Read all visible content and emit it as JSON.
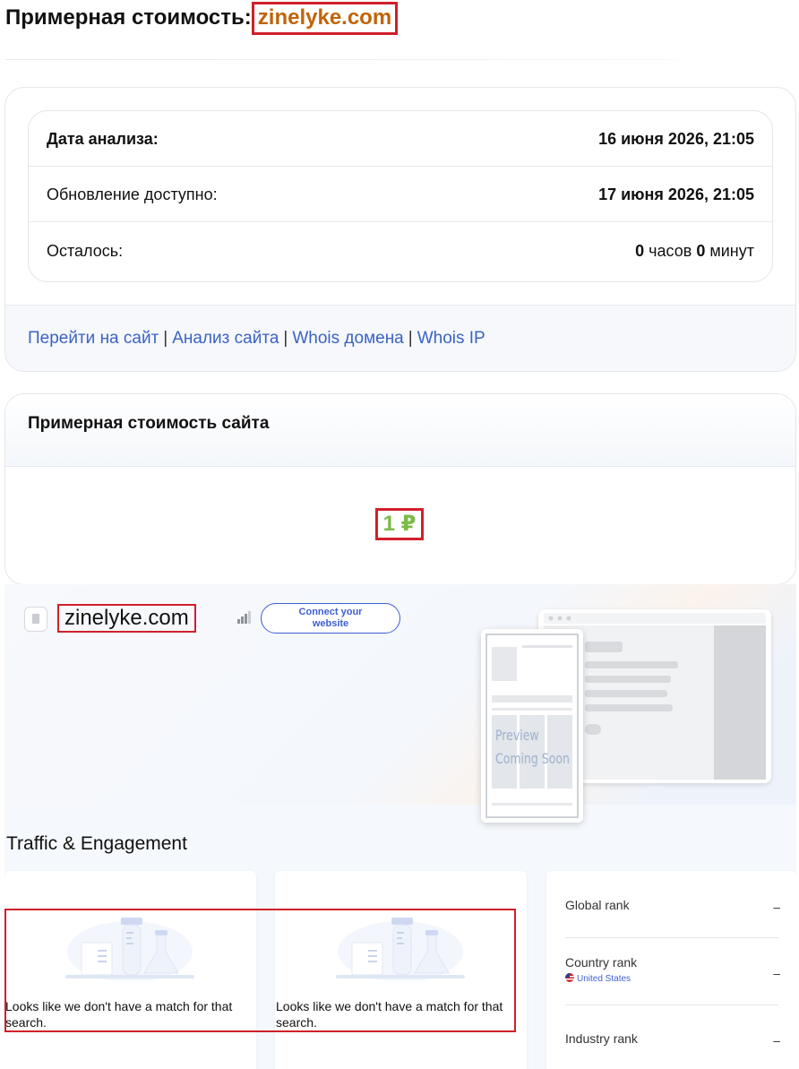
{
  "header": {
    "title_prefix": "Примерная стоимость:",
    "domain": "zinelyke.com"
  },
  "analysis": {
    "rows": [
      {
        "label": "Дата анализа:",
        "value": "16 июня 2026, 21:05"
      },
      {
        "label": "Обновление доступно:",
        "value": "17 июня 2026, 21:05"
      },
      {
        "label": "Осталось:",
        "hours": "0",
        "hours_unit": "часов",
        "minutes": "0",
        "minutes_unit": "минут"
      }
    ],
    "links": [
      "Перейти на сайт",
      "Анализ сайта",
      "Whois домена",
      "Whois IP"
    ],
    "separator": "|"
  },
  "estimate": {
    "title": "Примерная стоимость сайта",
    "price": "1 ₽"
  },
  "widget": {
    "site_name": "zinelyke.com",
    "connect_button": {
      "line1": "Connect your",
      "line2": "website"
    },
    "preview": {
      "line1": "Preview",
      "line2": "Coming Soon"
    },
    "traffic_title": "Traffic & Engagement",
    "no_match_text": "Looks like we don't have a match for that search.",
    "ranks": [
      {
        "label": "Global rank",
        "value": "–"
      },
      {
        "label": "Country rank",
        "value": "–",
        "sub": "United States"
      },
      {
        "label": "Industry rank",
        "value": "–"
      }
    ]
  },
  "colors": {
    "link": "#3b63c4",
    "domain_title": "#c0640a",
    "price": "#7cba4a",
    "highlight_border": "#d0202a",
    "accent_blue": "#3f5fd3"
  }
}
